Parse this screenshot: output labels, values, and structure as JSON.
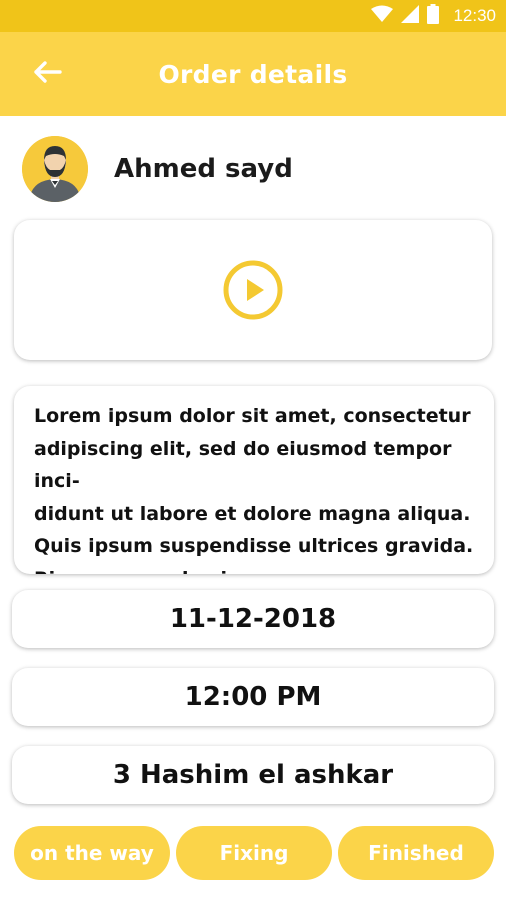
{
  "status_bar": {
    "time": "12:30"
  },
  "header": {
    "title": "Order details"
  },
  "customer": {
    "name": "Ahmed sayd"
  },
  "order": {
    "description": "Lorem ipsum dolor sit amet, consectetur\nadipiscing elit, sed do eiusmod tempor inci-\ndidunt ut labore et dolore magna aliqua.\nQuis ipsum suspendisse ultrices gravida.\nRisus commodo viverra maecenas ac-",
    "date": "11-12-2018",
    "time": "12:00 PM",
    "address": "3 Hashim el ashkar"
  },
  "actions": {
    "on_the_way": "on the way",
    "fixing": "Fixing",
    "finished": "Finished"
  },
  "colors": {
    "status_bar": "#f0c419",
    "accent": "#fbd449",
    "text": "#111111"
  },
  "icons": {
    "back": "arrow-left-icon",
    "play": "play-circle-icon",
    "wifi": "wifi-icon",
    "signal": "signal-icon",
    "battery": "battery-icon"
  }
}
